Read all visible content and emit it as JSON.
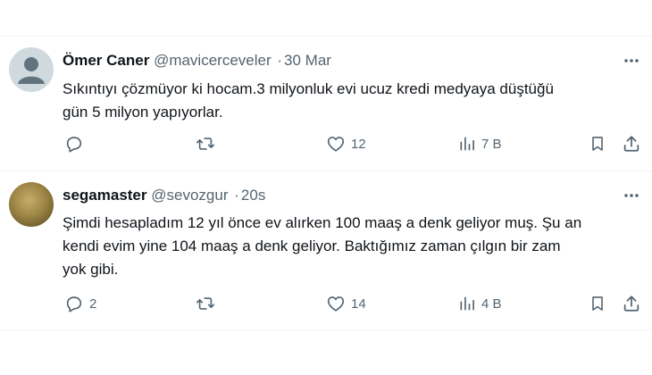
{
  "tweets": [
    {
      "name": "Ömer Caner",
      "handle": "@mavicerceveler",
      "separator": "·",
      "time": "30 Mar",
      "text_lines": [
        "Sıkıntıyı çözmüyor ki hocam.3 milyonluk evi ucuz kredi medyaya düştüğü",
        "gün 5 milyon yapıyorlar."
      ],
      "replies": "",
      "retweets": "",
      "likes": "12",
      "views": "7 B",
      "avatar": "default-gray-avatar"
    },
    {
      "name": "segamaster",
      "handle": "@sevozgur",
      "separator": "·",
      "time": "20s",
      "text_lines": [
        "Şimdi hesapladım 12 yıl önce ev alırken 100 maaş a denk geliyor muş. Şu an",
        "kendi evim yine 104 maaş a denk geliyor. Baktığımız zaman çılgın bir zam",
        "yok gibi."
      ],
      "replies": "2",
      "retweets": "",
      "likes": "14",
      "views": "4 B",
      "avatar": "olive-photo-avatar"
    }
  ],
  "colors": {
    "text": "#0f1419",
    "secondary": "#536471",
    "border": "#eff3f4"
  },
  "icons": [
    "more-icon",
    "reply-icon",
    "retweet-icon",
    "like-icon",
    "views-icon",
    "bookmark-icon",
    "share-icon"
  ]
}
